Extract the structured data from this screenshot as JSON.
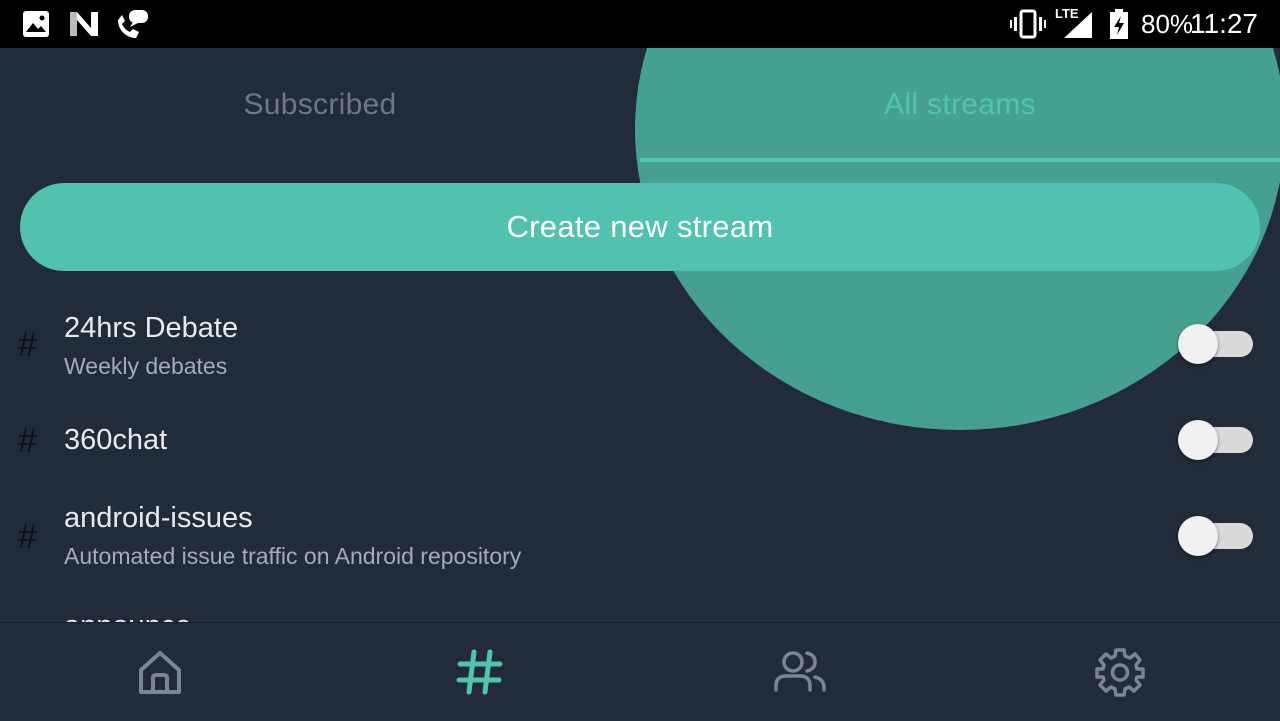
{
  "status_bar": {
    "battery": "80%",
    "time": "11:27",
    "network": "LTE",
    "left_icons": [
      "image-icon",
      "n-notification-icon",
      "missed-call-icon"
    ],
    "right_icons": [
      "vibrate-icon",
      "lte-signal-icon",
      "battery-charging-icon"
    ]
  },
  "tabs": [
    {
      "label": "Subscribed",
      "active": false
    },
    {
      "label": "All streams",
      "active": true
    }
  ],
  "create_button": {
    "label": "Create new stream"
  },
  "streams": [
    {
      "name": "24hrs Debate",
      "description": "Weekly debates",
      "subscribed": false
    },
    {
      "name": "360chat",
      "description": "",
      "subscribed": false
    },
    {
      "name": "android-issues",
      "description": "Automated issue traffic on Android repository",
      "subscribed": false
    },
    {
      "name": "announce",
      "description": "",
      "subscribed": false
    }
  ],
  "bottom_nav": [
    {
      "icon": "home-icon",
      "active": false
    },
    {
      "icon": "hash-icon",
      "active": true
    },
    {
      "icon": "people-icon",
      "active": false
    },
    {
      "icon": "settings-icon",
      "active": false
    }
  ],
  "colors": {
    "background": "#222b3a",
    "accent": "#50c4ae",
    "ripple": "#46a090",
    "inactive_tab": "#6f7783",
    "inactive_icon": "#7d8590"
  }
}
